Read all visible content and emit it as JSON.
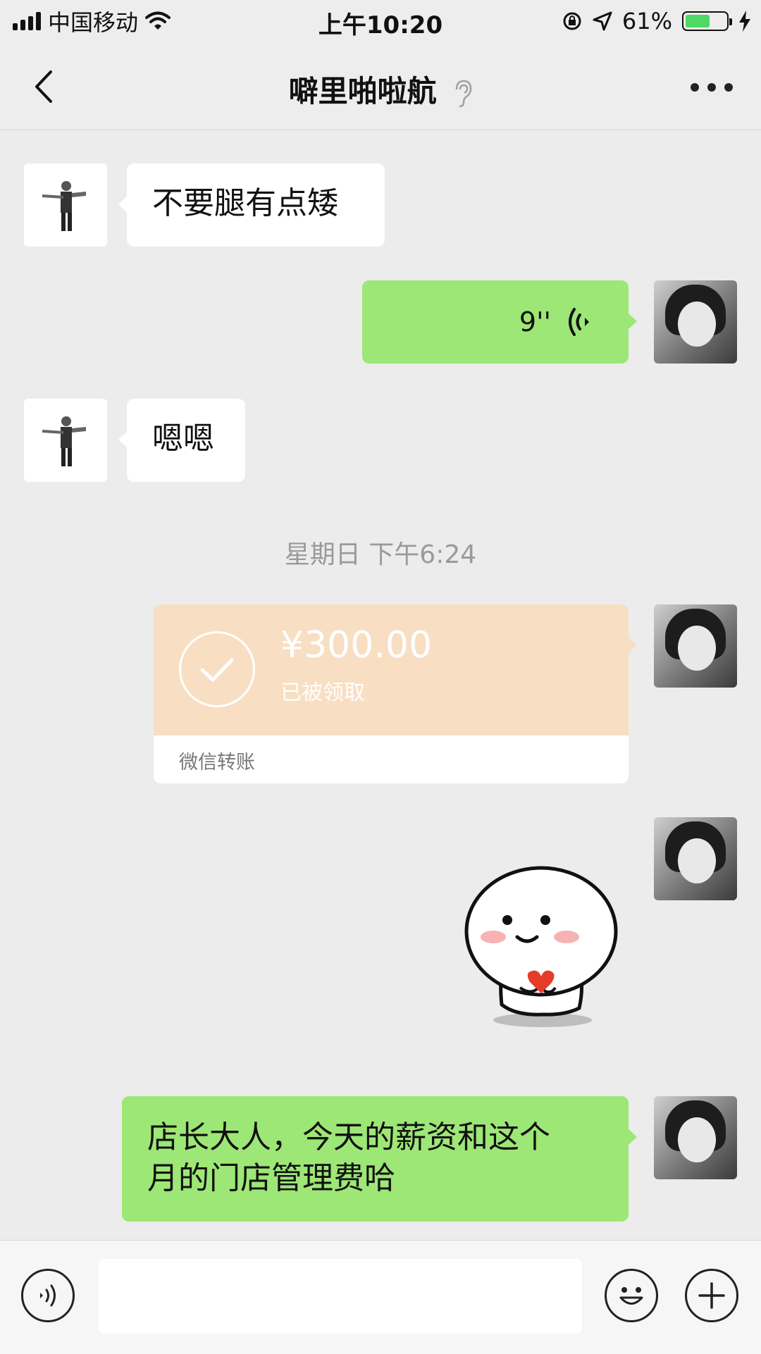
{
  "status_bar": {
    "carrier": "中国移动",
    "time": "上午10:20",
    "battery_percent_label": "61%",
    "battery_level": 0.61,
    "wifi_icon": "wifi-icon",
    "location_icon": "location-arrow-icon",
    "lock_icon": "rotation-lock-icon",
    "charging_icon": "charging-bolt-icon"
  },
  "nav": {
    "title": "噼里啪啦航",
    "back_icon": "chevron-left-icon",
    "ear_icon": "ear-icon",
    "more_icon": "more-dots-icon"
  },
  "messages": [
    {
      "side": "left",
      "type": "text",
      "text": "不要腿有点矮"
    },
    {
      "side": "right",
      "type": "voice",
      "duration": "9''"
    },
    {
      "side": "left",
      "type": "text",
      "text": "嗯嗯"
    },
    {
      "type": "timestamp",
      "text": "星期日 下午6:24"
    },
    {
      "side": "right",
      "type": "transfer",
      "amount": "¥300.00",
      "status": "已被领取",
      "label": "微信转账"
    },
    {
      "side": "right",
      "type": "sticker",
      "icon": "smiling-ghost-sticker"
    },
    {
      "side": "right",
      "type": "text",
      "text": "店长大人，今天的薪资和这个月的门店管理费哈",
      "line1": "店长大人，今天的薪资和这个",
      "line2": "月的门店管理费哈"
    }
  ],
  "input_bar": {
    "voice_icon": "voice-input-icon",
    "emoji_icon": "emoji-icon",
    "plus_icon": "plus-icon"
  },
  "colors": {
    "bubble_green": "#9de776",
    "transfer_bg": "#f8dfc3",
    "background": "#ececec"
  }
}
